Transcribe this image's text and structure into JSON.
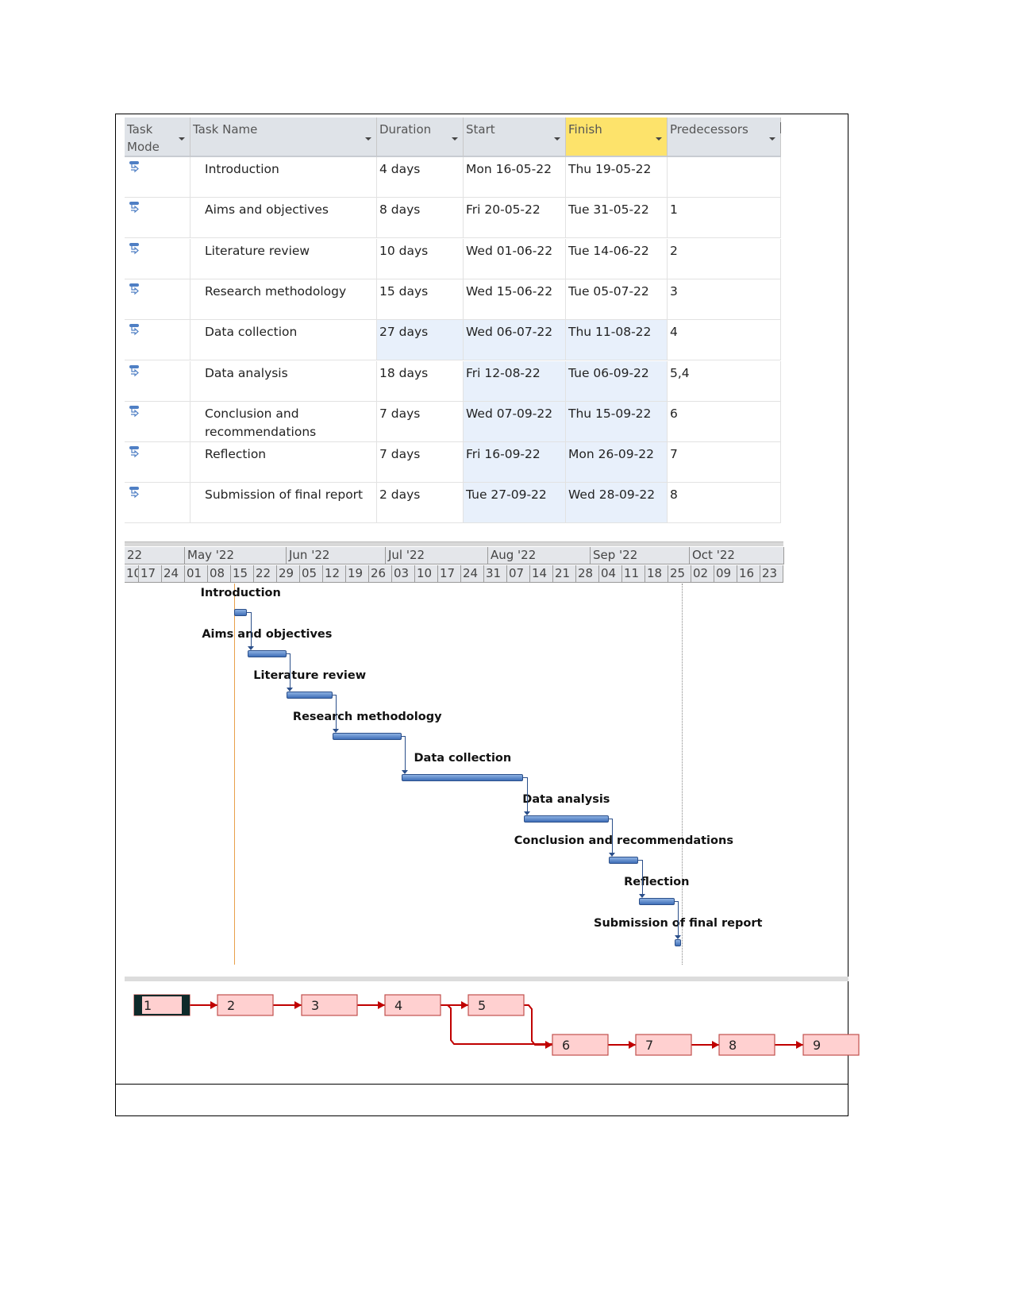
{
  "table": {
    "columns": [
      {
        "label": "Task Mode",
        "line1": "Task",
        "line2": "Mode"
      },
      {
        "label": "Task Name"
      },
      {
        "label": "Duration"
      },
      {
        "label": "Start"
      },
      {
        "label": "Finish"
      },
      {
        "label": "Predecessors"
      }
    ],
    "rows": [
      {
        "id": "1",
        "name": "Introduction",
        "duration": "4 days",
        "start": "Mon 16-05-22",
        "finish": "Thu 19-05-22",
        "predecessors": "",
        "s": "2022-05-16",
        "f": "2022-05-19"
      },
      {
        "id": "2",
        "name": "Aims and objectives",
        "duration": "8 days",
        "start": "Fri 20-05-22",
        "finish": "Tue 31-05-22",
        "predecessors": "1",
        "s": "2022-05-20",
        "f": "2022-05-31"
      },
      {
        "id": "3",
        "name": "Literature review",
        "duration": "10 days",
        "start": "Wed 01-06-22",
        "finish": "Tue 14-06-22",
        "predecessors": "2",
        "s": "2022-06-01",
        "f": "2022-06-14"
      },
      {
        "id": "4",
        "name": "Research methodology",
        "duration": "15 days",
        "start": "Wed 15-06-22",
        "finish": "Tue 05-07-22",
        "predecessors": "3",
        "s": "2022-06-15",
        "f": "2022-07-05"
      },
      {
        "id": "5",
        "name": "Data collection",
        "duration": "27 days",
        "start": "Wed 06-07-22",
        "finish": "Thu 11-08-22",
        "predecessors": "4",
        "s": "2022-07-06",
        "f": "2022-08-11"
      },
      {
        "id": "6",
        "name": "Data analysis",
        "duration": "18 days",
        "start": "Fri 12-08-22",
        "finish": "Tue 06-09-22",
        "predecessors": "5,4",
        "s": "2022-08-12",
        "f": "2022-09-06"
      },
      {
        "id": "7",
        "name": "Conclusion and recommendations",
        "name1": "Conclusion and",
        "name2": "recommendations",
        "duration": "7 days",
        "start": "Wed 07-09-22",
        "finish": "Thu 15-09-22",
        "predecessors": "6",
        "s": "2022-09-07",
        "f": "2022-09-15"
      },
      {
        "id": "8",
        "name": "Reflection",
        "duration": "7 days",
        "start": "Fri 16-09-22",
        "finish": "Mon 26-09-22",
        "predecessors": "7",
        "s": "2022-09-16",
        "f": "2022-09-26"
      },
      {
        "id": "9",
        "name": "Submission of final report",
        "duration": "2 days",
        "start": "Tue 27-09-22",
        "finish": "Wed 28-09-22",
        "predecessors": "8",
        "s": "2022-09-27",
        "f": "2022-09-28"
      }
    ],
    "task_mode_icon": "auto-scheduled-task-icon",
    "highlighted_column": "Finish",
    "highlight_color": "#fde36b"
  },
  "timeline": {
    "months": [
      "'22",
      "May '22",
      "Jun '22",
      "Jul '22",
      "Aug '22",
      "Sep '22",
      "Oct '22"
    ],
    "weeks": [
      "10",
      "17",
      "24",
      "01",
      "08",
      "15",
      "22",
      "29",
      "05",
      "12",
      "19",
      "26",
      "03",
      "10",
      "17",
      "24",
      "31",
      "07",
      "14",
      "21",
      "28",
      "04",
      "11",
      "18",
      "25",
      "02",
      "09",
      "16",
      "23"
    ],
    "bar_color": "#4f7fc4",
    "today_line_color": "#e8a04a"
  },
  "network": {
    "nodes": [
      "1",
      "2",
      "3",
      "4",
      "5",
      "6",
      "7",
      "8",
      "9"
    ],
    "node_fill": "#ffd0d0",
    "link_color": "#c00000"
  }
}
